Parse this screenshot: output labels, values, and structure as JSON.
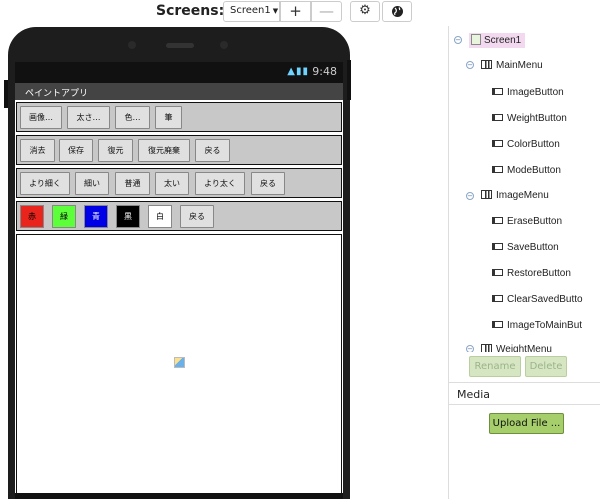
{
  "toolbar": {
    "screens_label": "Screens:",
    "screen_select": "Screen1",
    "add_icon": "+",
    "remove_icon": "—",
    "gear_icon": "gear-icon",
    "globe_icon": "globe-icon"
  },
  "phone": {
    "status_time": "9:48",
    "app_title": "ペイントアプリ",
    "rows": [
      {
        "name": "main-menu-row",
        "buttons": [
          "画像…",
          "太さ…",
          "色…",
          "筆"
        ]
      },
      {
        "name": "image-menu-row",
        "buttons": [
          "消去",
          "保存",
          "復元",
          "復元廃棄",
          "戻る"
        ]
      },
      {
        "name": "weight-menu-row",
        "buttons": [
          "より細く",
          "細い",
          "普通",
          "太い",
          "より太く",
          "戻る"
        ]
      }
    ],
    "color_row": {
      "colors": [
        {
          "label": "赤",
          "color": "#e8241c"
        },
        {
          "label": "緑",
          "color": "#5cff3a"
        },
        {
          "label": "青",
          "color": "#0000e6"
        },
        {
          "label": "黒",
          "color": "#000000"
        },
        {
          "label": "白",
          "color": "#ffffff"
        }
      ],
      "back": "戻る"
    }
  },
  "tree": {
    "screen": "Screen1",
    "main_menu": "MainMenu",
    "main_items": [
      "ImageButton",
      "WeightButton",
      "ColorButton",
      "ModeButton"
    ],
    "image_menu": "ImageMenu",
    "image_items": [
      "EraseButton",
      "SaveButton",
      "RestoreButton",
      "ClearSavedButto",
      "ImageToMainBut"
    ],
    "weight_menu": "WeightMenu",
    "rename": "Rename",
    "delete": "Delete"
  },
  "media": {
    "title": "Media",
    "upload": "Upload File ..."
  }
}
